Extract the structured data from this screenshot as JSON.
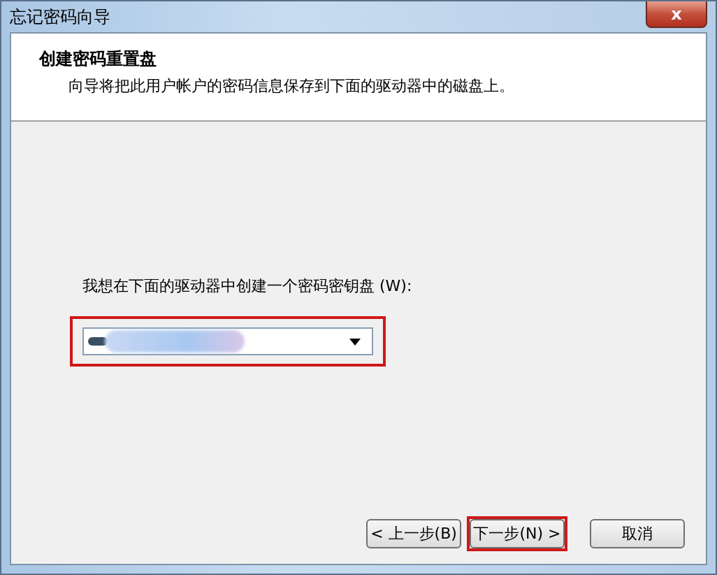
{
  "window": {
    "title": "忘记密码向导",
    "close": "x"
  },
  "header": {
    "title": "创建密码重置盘",
    "subtitle": "向导将把此用户帐户的密码信息保存到下面的驱动器中的磁盘上。"
  },
  "body": {
    "label": "我想在下面的驱动器中创建一个密码密钥盘 (W):",
    "dropdown": {
      "highlighted": true
    }
  },
  "buttons": [
    {
      "label": "< 上一步(B)",
      "highlighted": false
    },
    {
      "label": "下一步(N) >",
      "highlighted": true
    },
    {
      "label": "取消",
      "highlighted": false
    }
  ]
}
